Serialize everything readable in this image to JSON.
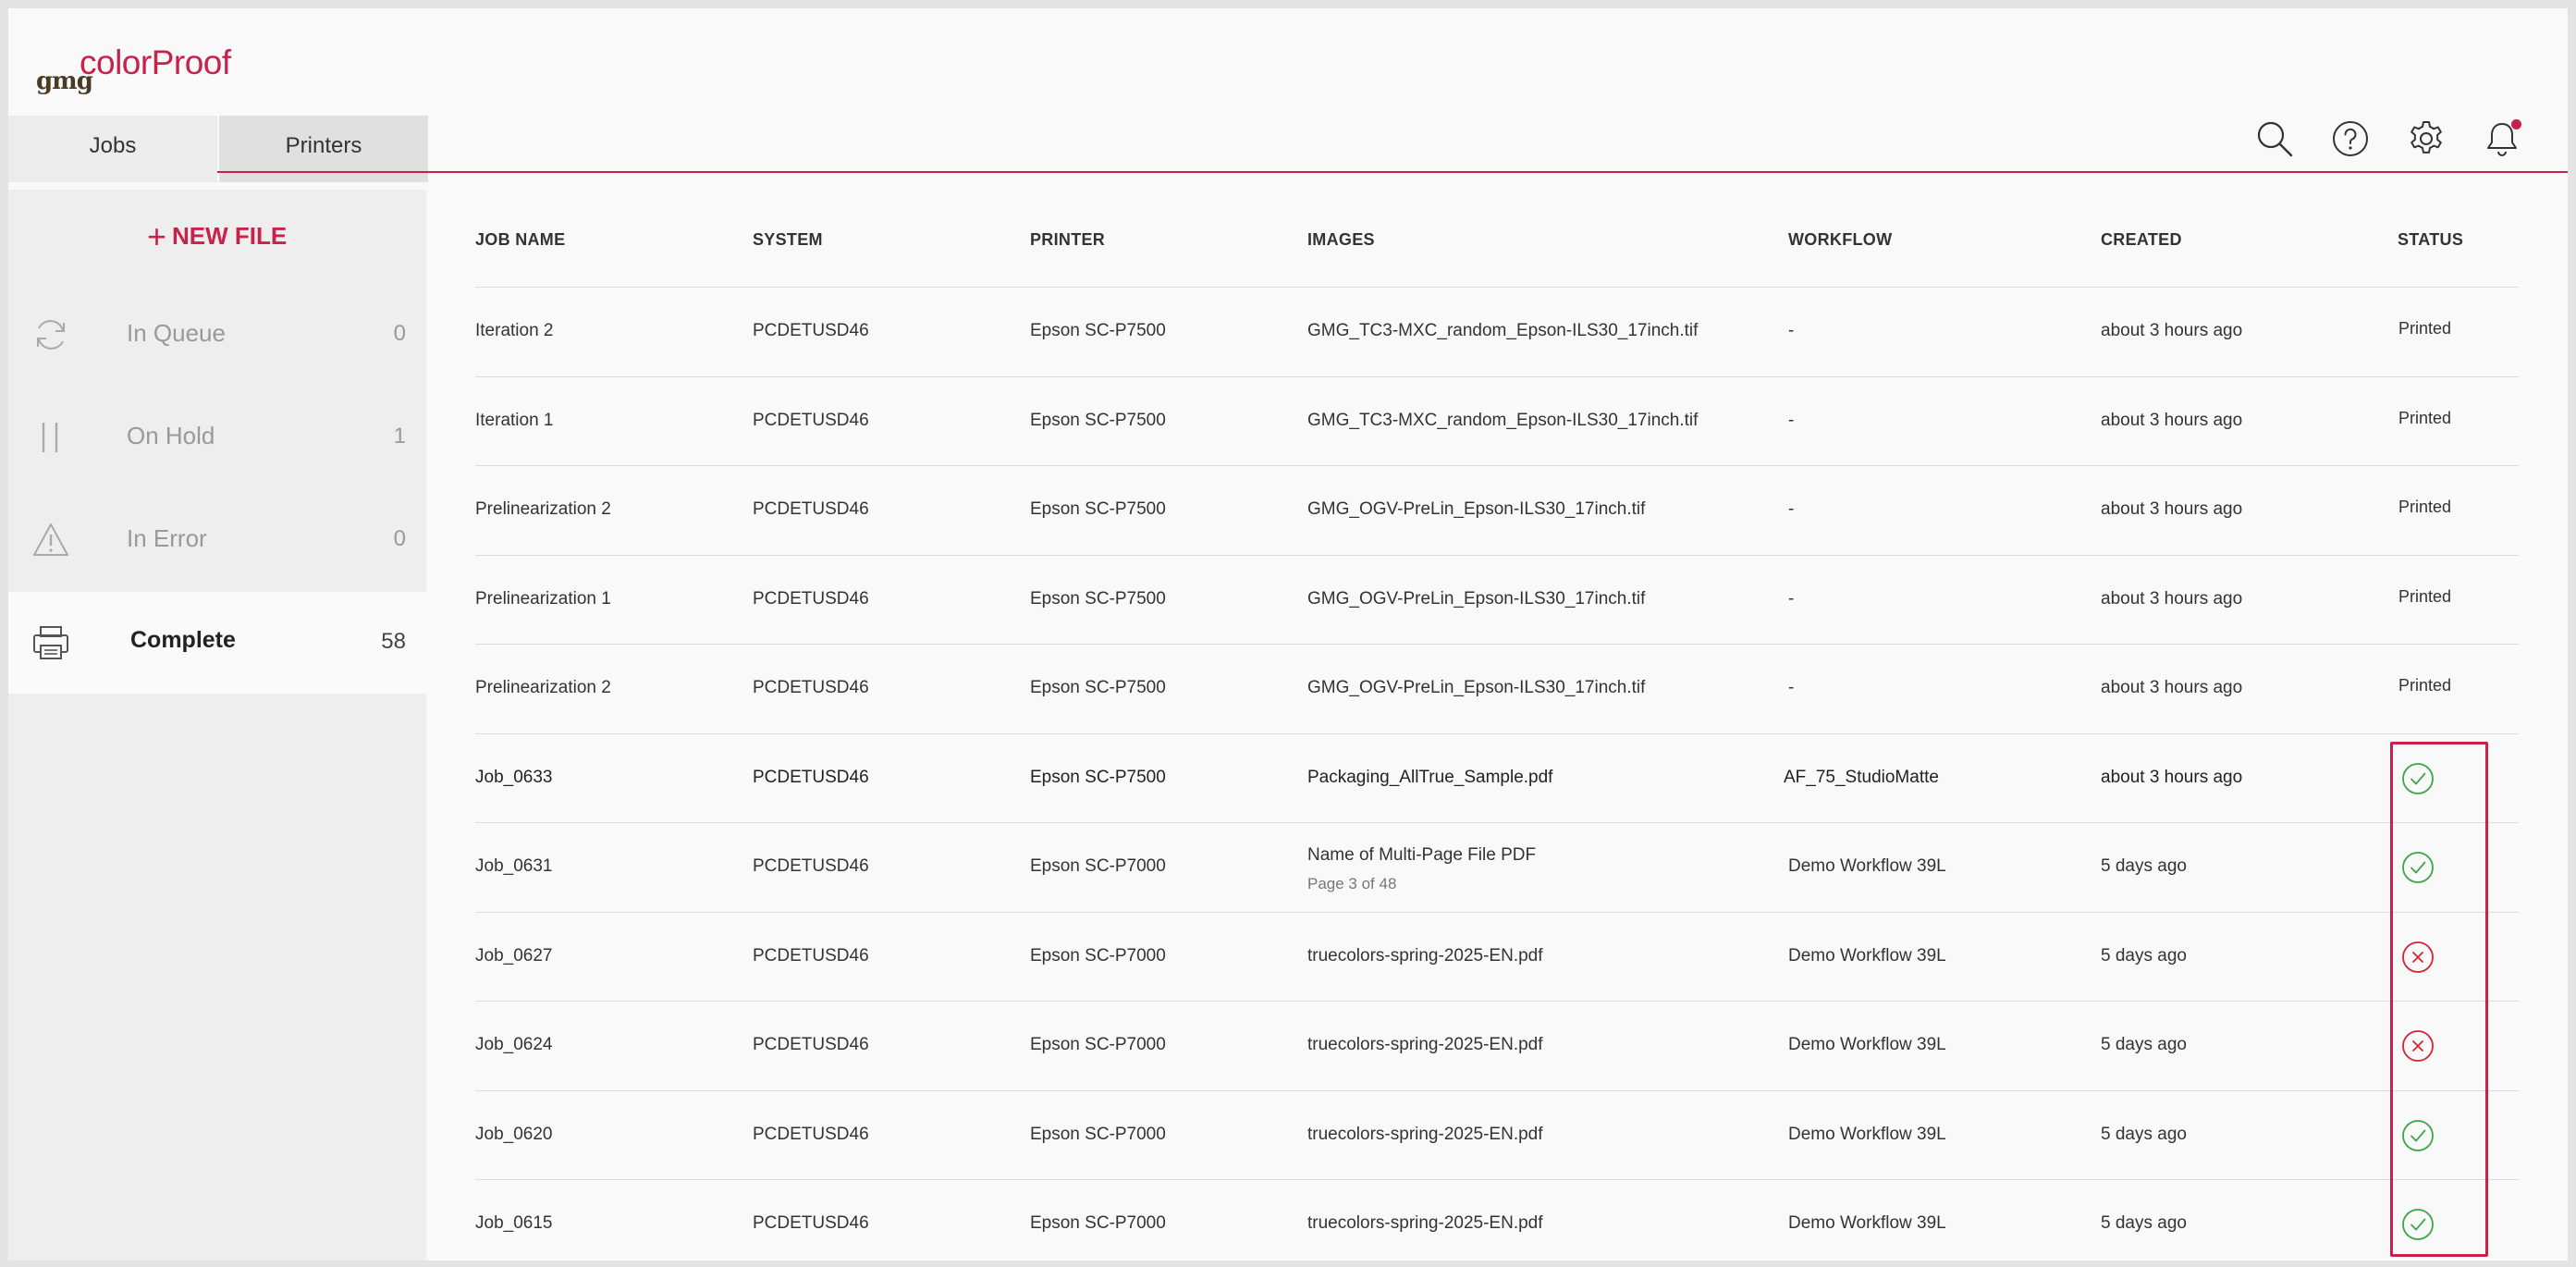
{
  "app": {
    "logo_prefix": "gmg",
    "logo_name": "colorProof"
  },
  "tabs": [
    {
      "label": "Jobs"
    },
    {
      "label": "Printers"
    }
  ],
  "header_icons": [
    "search-icon",
    "help-icon",
    "gear-icon",
    "bell-icon"
  ],
  "sidebar": {
    "new_file_label": "NEW FILE",
    "items": [
      {
        "label": "In Queue",
        "count": "0",
        "icon": "refresh-icon"
      },
      {
        "label": "On Hold",
        "count": "1",
        "icon": "pause-icon"
      },
      {
        "label": "In Error",
        "count": "0",
        "icon": "warning-icon"
      },
      {
        "label": "Complete",
        "count": "58",
        "icon": "printer-icon"
      }
    ]
  },
  "table": {
    "headers": [
      "JOB NAME",
      "SYSTEM",
      "PRINTER",
      "IMAGES",
      "WORKFLOW",
      "CREATED",
      "STATUS"
    ],
    "rows": [
      {
        "job": "Iteration 2",
        "system": "PCDETUSD46",
        "printer": "Epson SC-P7500",
        "images": "GMG_TC3-MXC_random_Epson-ILS30_17inch.tif",
        "images_sub": "",
        "workflow": "-",
        "created": "about 3 hours ago",
        "status": "Printed",
        "status_type": "text"
      },
      {
        "job": "Iteration 1",
        "system": "PCDETUSD46",
        "printer": "Epson SC-P7500",
        "images": "GMG_TC3-MXC_random_Epson-ILS30_17inch.tif",
        "images_sub": "",
        "workflow": "-",
        "created": "about 3 hours ago",
        "status": "Printed",
        "status_type": "text"
      },
      {
        "job": "Prelinearization 2",
        "system": "PCDETUSD46",
        "printer": "Epson SC-P7500",
        "images": "GMG_OGV-PreLin_Epson-ILS30_17inch.tif",
        "images_sub": "",
        "workflow": "-",
        "created": "about 3 hours ago",
        "status": "Printed",
        "status_type": "text"
      },
      {
        "job": "Prelinearization 1",
        "system": "PCDETUSD46",
        "printer": "Epson SC-P7500",
        "images": "GMG_OGV-PreLin_Epson-ILS30_17inch.tif",
        "images_sub": "",
        "workflow": "-",
        "created": "about 3 hours ago",
        "status": "Printed",
        "status_type": "text"
      },
      {
        "job": "Prelinearization 2",
        "system": "PCDETUSD46",
        "printer": "Epson SC-P7500",
        "images": "GMG_OGV-PreLin_Epson-ILS30_17inch.tif",
        "images_sub": "",
        "workflow": "-",
        "created": "about 3 hours ago",
        "status": "Printed",
        "status_type": "text"
      },
      {
        "job": "Job_0633",
        "system": "PCDETUSD46",
        "printer": "Epson SC-P7500",
        "images": "Packaging_AllTrue_Sample.pdf",
        "images_sub": "",
        "workflow": "AF_75_StudioMatte",
        "created": "about 3 hours ago",
        "status": "",
        "status_type": "success"
      },
      {
        "job": "Job_0631",
        "system": "PCDETUSD46",
        "printer": "Epson SC-P7000",
        "images": "Name of Multi-Page File PDF",
        "images_sub": "Page 3 of 48",
        "workflow": "Demo Workflow 39L",
        "created": "5 days ago",
        "status": "",
        "status_type": "success"
      },
      {
        "job": "Job_0627",
        "system": "PCDETUSD46",
        "printer": "Epson SC-P7000",
        "images": "truecolors-spring-2025-EN.pdf",
        "images_sub": "",
        "workflow": "Demo Workflow 39L",
        "created": "5 days ago",
        "status": "",
        "status_type": "error"
      },
      {
        "job": "Job_0624",
        "system": "PCDETUSD46",
        "printer": "Epson SC-P7000",
        "images": "truecolors-spring-2025-EN.pdf",
        "images_sub": "",
        "workflow": "Demo Workflow 39L",
        "created": "5 days ago",
        "status": "",
        "status_type": "error"
      },
      {
        "job": "Job_0620",
        "system": "PCDETUSD46",
        "printer": "Epson SC-P7000",
        "images": "truecolors-spring-2025-EN.pdf",
        "images_sub": "",
        "workflow": "Demo Workflow 39L",
        "created": "5 days ago",
        "status": "",
        "status_type": "success"
      },
      {
        "job": "Job_0615",
        "system": "PCDETUSD46",
        "printer": "Epson SC-P7000",
        "images": "truecolors-spring-2025-EN.pdf",
        "images_sub": "",
        "workflow": "Demo Workflow 39L",
        "created": "5 days ago",
        "status": "",
        "status_type": "success"
      }
    ]
  },
  "colors": {
    "accent": "#c8224a",
    "success": "#3aa64a",
    "error": "#d42435"
  }
}
